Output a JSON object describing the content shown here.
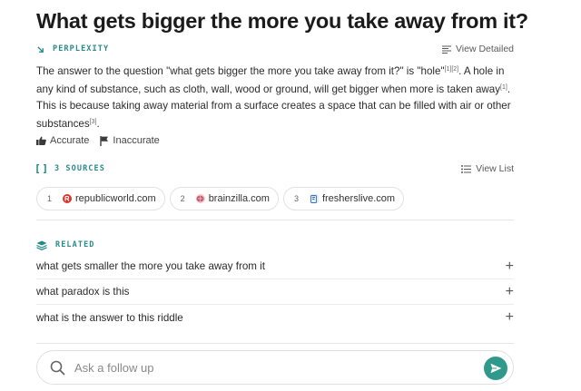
{
  "question": "What gets bigger the more you take away from it?",
  "answer_section": {
    "label": "PERPLEXITY",
    "view_detailed": "View Detailed",
    "text_parts": [
      "The answer to the question \"what gets bigger the more you take away from it?\" is \"hole\"",
      "[1][2]",
      ". A hole in any kind of substance, such as cloth, wall, wood or ground, will get bigger when more is taken away",
      "[1]",
      ". This is because taking away material from a surface creates a space that can be filled with air or other substances",
      "[3]",
      "."
    ]
  },
  "feedback": {
    "accurate": "Accurate",
    "inaccurate": "Inaccurate"
  },
  "sources_section": {
    "label": "3 SOURCES",
    "view_list": "View List",
    "items": [
      {
        "num": "1",
        "site": "republicworld.com",
        "favicon_color": "#d9342b"
      },
      {
        "num": "2",
        "site": "brainzilla.com",
        "favicon_color": "#c45a6a"
      },
      {
        "num": "3",
        "site": "fresherslive.com",
        "favicon_color": "#3b6fb6"
      }
    ]
  },
  "related_section": {
    "label": "RELATED",
    "items": [
      "what gets smaller the more you take away from it",
      "what paradox is this",
      "what is the answer to this riddle"
    ]
  },
  "followup": {
    "placeholder": "Ask a follow up"
  },
  "colors": {
    "accent": "#2f9a8c",
    "label_teal": "#2a8a8a"
  }
}
